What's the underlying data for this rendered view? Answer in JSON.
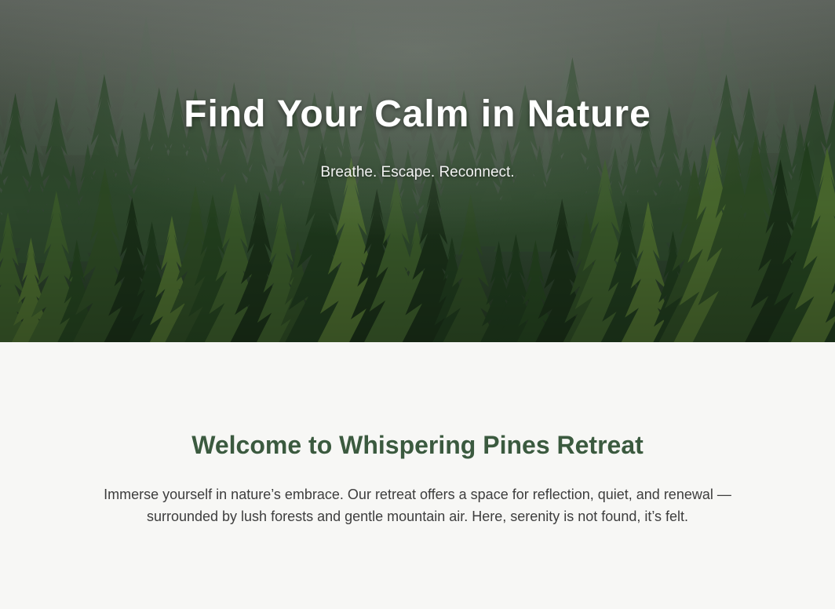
{
  "hero": {
    "title": "Find Your Calm in Nature",
    "subtitle": "Breathe. Escape. Reconnect.",
    "background_image": "misty-pine-forest"
  },
  "welcome": {
    "title": "Welcome to Whispering Pines Retreat",
    "text": "Immerse yourself in nature’s embrace. Our retreat offers a space for reflection, quiet, and renewal — surrounded by lush forests and gentle mountain air. Here, serenity is not found, it’s felt."
  },
  "colors": {
    "page_background": "#f7f7f5",
    "heading_green": "#3b5a3f",
    "body_text": "#3d3d3d",
    "hero_text": "#ffffff"
  }
}
